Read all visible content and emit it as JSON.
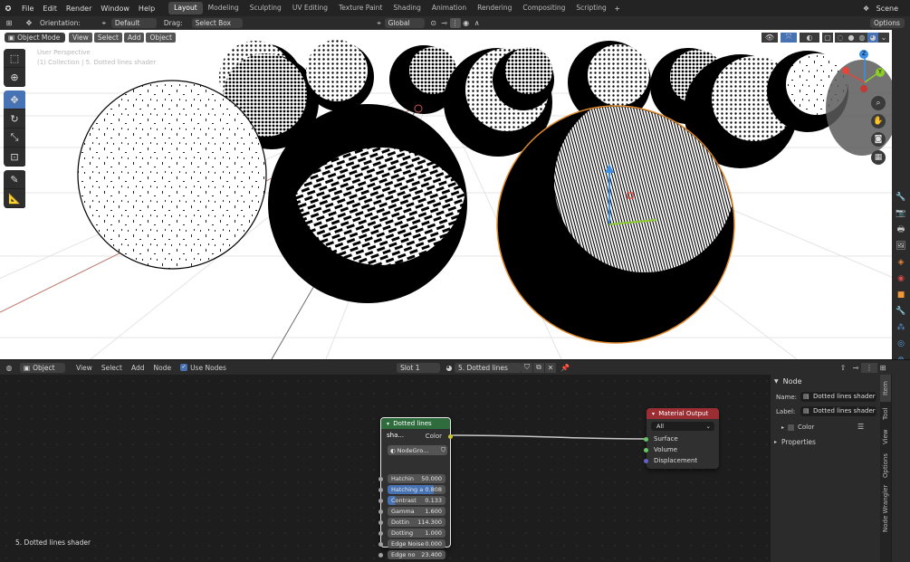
{
  "menubar": {
    "items": [
      "File",
      "Edit",
      "Render",
      "Window",
      "Help"
    ],
    "workspaces": [
      "Layout",
      "Modeling",
      "Sculpting",
      "UV Editing",
      "Texture Paint",
      "Shading",
      "Animation",
      "Rendering",
      "Compositing",
      "Scripting"
    ],
    "active_workspace": "Layout",
    "scene_label": "Scene"
  },
  "header": {
    "orientation_label": "Orientation:",
    "orientation_value": "Default",
    "drag_label": "Drag:",
    "drag_value": "Select Box",
    "transform_value": "Global",
    "options_label": "Options"
  },
  "viewport_header": {
    "mode": "Object Mode",
    "menus": [
      "View",
      "Select",
      "Add",
      "Object"
    ]
  },
  "viewport": {
    "overlay_title": "User Perspective",
    "overlay_subtitle": "(1) Collection | 5. Dotted lines shader"
  },
  "gizmo": {
    "x": "X",
    "y": "Y",
    "z": "Z",
    "colors": {
      "x": "#e4463d",
      "y": "#8bcc2b",
      "z": "#3a8ee4"
    }
  },
  "node_editor_header": {
    "type_value": "Object",
    "menus": [
      "View",
      "Select",
      "Add",
      "Node"
    ],
    "use_nodes_label": "Use Nodes",
    "slot_value": "Slot 1",
    "material_name": "5. Dotted lines shader"
  },
  "group_node": {
    "title": "Dotted lines sha...",
    "output_label": "Color",
    "group_value": "NodeGro...",
    "inputs": [
      {
        "label": "Hatchin",
        "value": "50.000",
        "fill": 0
      },
      {
        "label": "Hatching a",
        "value": "0.808",
        "fill": 0.8
      },
      {
        "label": "Contrast",
        "value": "0.133",
        "fill": 0.13
      },
      {
        "label": "Gamma",
        "value": "1.600",
        "fill": 0
      },
      {
        "label": "Dottin",
        "value": "114.300",
        "fill": 0
      },
      {
        "label": "Dotting",
        "value": "1.000",
        "fill": 0
      },
      {
        "label": "Edge Noise",
        "value": "0.000",
        "fill": 0
      },
      {
        "label": "Edge no",
        "value": "23.400",
        "fill": 0
      }
    ],
    "header_color": "#2e6b3d"
  },
  "material_output_node": {
    "title": "Material Output",
    "target_value": "All",
    "inputs": [
      "Surface",
      "Volume",
      "Displacement"
    ],
    "header_color": "#9a2e33"
  },
  "node_panel": {
    "section_title": "Node",
    "name_label": "Name:",
    "name_value": "Dotted lines shader",
    "label_label": "Label:",
    "label_value": "Dotted lines shader",
    "color_label": "Color",
    "properties_label": "Properties",
    "tabs": [
      "Item",
      "Tool",
      "View",
      "Options",
      "Node Wrangler"
    ]
  },
  "canvas_label": "5. Dotted lines shader"
}
